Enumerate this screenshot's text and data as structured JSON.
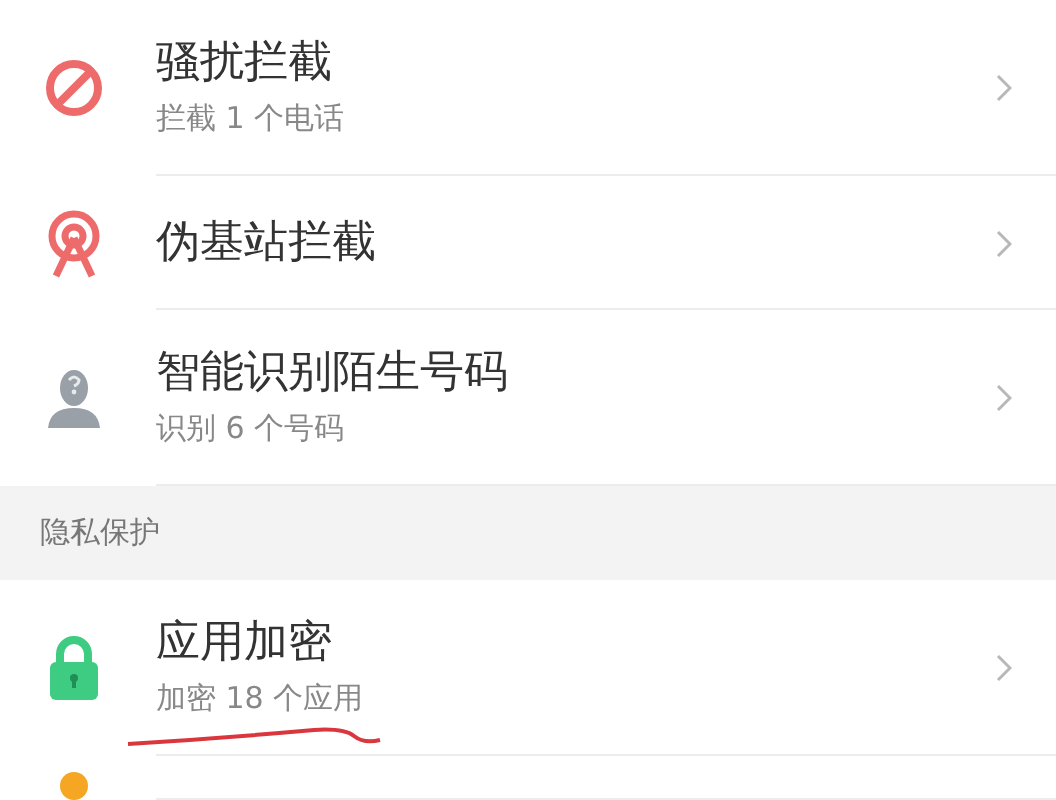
{
  "groups": [
    {
      "items": [
        {
          "kind": "block",
          "title": "骚扰拦截",
          "subtitle": "拦截 1 个电话",
          "underlined": false
        },
        {
          "kind": "antenna",
          "title": "伪基站拦截",
          "underlined": false
        },
        {
          "kind": "unknown",
          "title": "智能识别陌生号码",
          "subtitle": "识别 6 个号码",
          "underlined": false
        }
      ]
    },
    {
      "header": "隐私保护",
      "items": [
        {
          "kind": "lock",
          "title": "应用加密",
          "subtitle": "加密 18 个应用",
          "underlined": true
        },
        {
          "kind": "partial"
        }
      ]
    }
  ]
}
